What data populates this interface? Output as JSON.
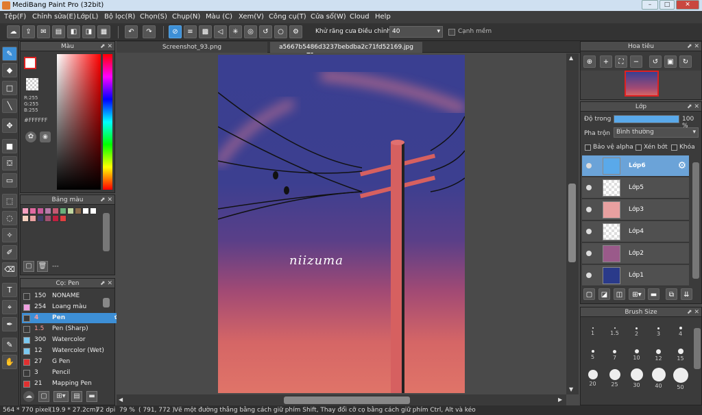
{
  "window": {
    "title": "MediBang Paint Pro (32bit)"
  },
  "menu": [
    "Tệp(F)",
    "Chỉnh sửa(E)",
    "Lớp(L)",
    "Bộ lọc(R)",
    "Chọn(S)",
    "Chụp(N)",
    "Màu (C)",
    "Xem(V)",
    "Công cụ(T)",
    "Cửa sổ(W)",
    "Cloud",
    "Help"
  ],
  "toolbar": {
    "antialias_label": "Khử răng cưa",
    "correction_label": "Điều chỉnh",
    "correction_value": "40",
    "smooth_label": "Cạnh mềm"
  },
  "tabs": [
    "Screenshot_93.png",
    "a5667b5486d3237bebdba2c71fd52169.jpg"
  ],
  "color_panel": {
    "title": "Màu",
    "r": "R:255",
    "g": "G:255",
    "b": "B:255",
    "hex": "#FFFFFF"
  },
  "palette_panel": {
    "title": "Bảng màu",
    "footer": "---",
    "colors": [
      "#f5a0c0",
      "#e06aa0",
      "#c85a9a",
      "#b87aaa",
      "#c45a72",
      "#6ab07a",
      "#c0d6a0",
      "#8a6a4a",
      "#ffffff",
      "#ffffff",
      "#f5d2c0",
      "#e8a0a0",
      "#40406a",
      "#a05070",
      "#c02040",
      "#e04040"
    ]
  },
  "brush_panel": {
    "title": "Cọ: Pen",
    "items": [
      {
        "size": "150",
        "name": "NONAME",
        "color": "#3a3a3a"
      },
      {
        "size": "254",
        "name": "Loang màu",
        "color": "#f0a0e0"
      },
      {
        "size": "4",
        "name": "Pen",
        "color": "#3a3a3a"
      },
      {
        "size": "1.5",
        "name": "Pen (Sharp)",
        "color": "#3a3a3a"
      },
      {
        "size": "300",
        "name": "Watercolor",
        "color": "#7ac8f0"
      },
      {
        "size": "12",
        "name": "Watercolor (Wet)",
        "color": "#7ac8f0"
      },
      {
        "size": "27",
        "name": "G Pen",
        "color": "#e03030"
      },
      {
        "size": "3",
        "name": "Pencil",
        "color": "#3a3a3a"
      },
      {
        "size": "21",
        "name": "Mapping Pen",
        "color": "#e03030"
      }
    ]
  },
  "navigator": {
    "title": "Hoa tiêu"
  },
  "layer_panel": {
    "title": "Lớp",
    "opacity_label": "Độ trong",
    "opacity_value": "100 %",
    "opacity_fraction": 1.0,
    "blend_label": "Pha trộn",
    "blend_value": "Bình thường",
    "protect_alpha": "Bảo vệ alpha",
    "clipping": "Xén bớt",
    "lock": "Khóa",
    "layers": [
      {
        "name": "Lớp6"
      },
      {
        "name": "Lớp5"
      },
      {
        "name": "Lớp3"
      },
      {
        "name": "Lớp4"
      },
      {
        "name": "Lớp2"
      },
      {
        "name": "Lớp1"
      }
    ]
  },
  "brush_size_panel": {
    "title": "Brush Size",
    "sizes": [
      "1",
      "1.5",
      "2",
      "3",
      "4",
      "5",
      "7",
      "10",
      "12",
      "15",
      "20",
      "25",
      "30",
      "40",
      "50"
    ]
  },
  "canvas": {
    "signature": "niizuma"
  },
  "status": {
    "size": "564 * 770 pixel",
    "cm": "(19.9 * 27.2cm)",
    "dpi": "72 dpi",
    "zoom": "79 %",
    "coords": "( 791, 772 )",
    "hint": "Vẽ một đường thẳng bằng cách giữ phím Shift, Thay đổi cỡ cọ bằng cách giữ phím Ctrl, Alt và kéo"
  },
  "colors": {
    "accent": "#3d8fd6",
    "selected_layer": "#6ba3d8",
    "fg": "#ffffff"
  }
}
